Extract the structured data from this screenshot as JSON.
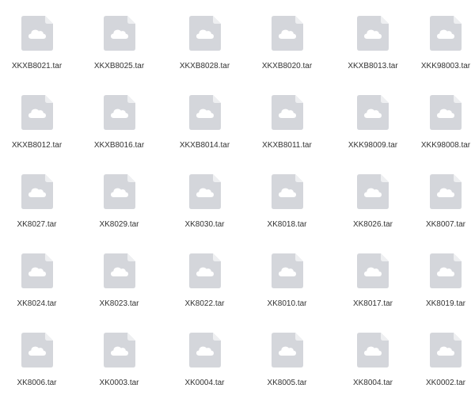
{
  "colors": {
    "icon_fill": "#d4d6db",
    "icon_fold": "#eeeff1",
    "cloud": "#ffffff",
    "label": "#333333",
    "background": "#ffffff"
  },
  "icon": "cloud-file-icon",
  "files": [
    {
      "name": "XKXB8021.tar"
    },
    {
      "name": "XKXB8025.tar"
    },
    {
      "name": "XKXB8028.tar"
    },
    {
      "name": "XKXB8020.tar"
    },
    {
      "name": "XKXB8013.tar"
    },
    {
      "name": "XKK98003.tar"
    },
    {
      "name": "XKXB8012.tar"
    },
    {
      "name": "XKXB8016.tar"
    },
    {
      "name": "XKXB8014.tar"
    },
    {
      "name": "XKXB8011.tar"
    },
    {
      "name": "XKK98009.tar"
    },
    {
      "name": "XKK98008.tar"
    },
    {
      "name": "XK8027.tar"
    },
    {
      "name": "XK8029.tar"
    },
    {
      "name": "XK8030.tar"
    },
    {
      "name": "XK8018.tar"
    },
    {
      "name": "XK8026.tar"
    },
    {
      "name": "XK8007.tar"
    },
    {
      "name": "XK8024.tar"
    },
    {
      "name": "XK8023.tar"
    },
    {
      "name": "XK8022.tar"
    },
    {
      "name": "XK8010.tar"
    },
    {
      "name": "XK8017.tar"
    },
    {
      "name": "XK8019.tar"
    },
    {
      "name": "XK8006.tar"
    },
    {
      "name": "XK0003.tar"
    },
    {
      "name": "XK0004.tar"
    },
    {
      "name": "XK8005.tar"
    },
    {
      "name": "XK8004.tar"
    },
    {
      "name": "XK0002.tar"
    }
  ]
}
